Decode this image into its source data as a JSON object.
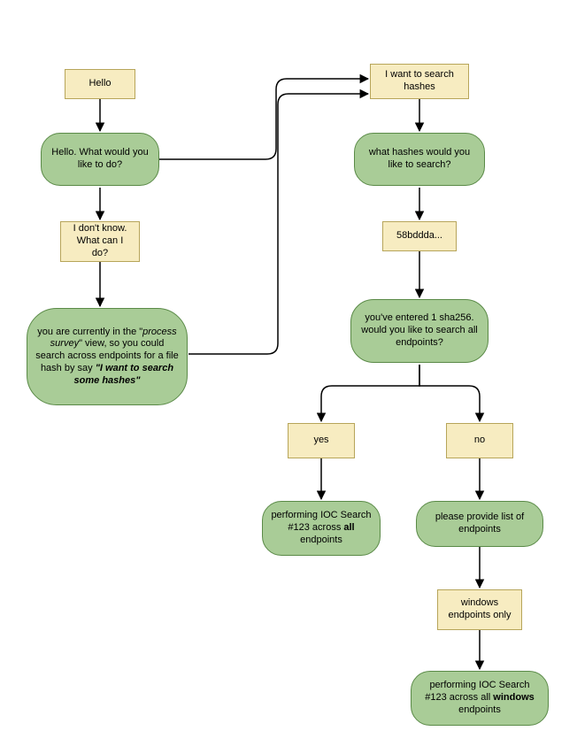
{
  "nodes": {
    "hello": {
      "text": "Hello"
    },
    "whatdo": {
      "text": "Hello. What would you like to do?"
    },
    "dontknow": {
      "text": "I don't know.\nWhat can I do?"
    },
    "survey_pre": "you are currently in the \"",
    "survey_em1": "process survey",
    "survey_mid": "\" view, so you could search across endpoints for a file hash by say ",
    "survey_em2": "\"I want to search some hashes\"",
    "wanthash": {
      "text": "I want to search hashes"
    },
    "whathash": {
      "text": "what hashes would you like to search?"
    },
    "hashval": {
      "text": "58bddda..."
    },
    "entered": {
      "text": "you've entered 1 sha256. would you like to search all endpoints?"
    },
    "yes": {
      "text": "yes"
    },
    "no": {
      "text": "no"
    },
    "ioc_all_pre": "performing IOC Search #123 across ",
    "ioc_all_bold": "all",
    "ioc_all_post": " endpoints",
    "provide": {
      "text": "please provide list of endpoints"
    },
    "winonly": {
      "text": "windows endpoints only"
    },
    "ioc_win_pre": "performing IOC Search #123 across all ",
    "ioc_win_bold": "windows",
    "ioc_win_post": " endpoints"
  },
  "colors": {
    "user_fill": "#f7ecc1",
    "user_stroke": "#b7a55a",
    "bot_fill": "#a9cc97",
    "bot_stroke": "#5a8a47"
  }
}
